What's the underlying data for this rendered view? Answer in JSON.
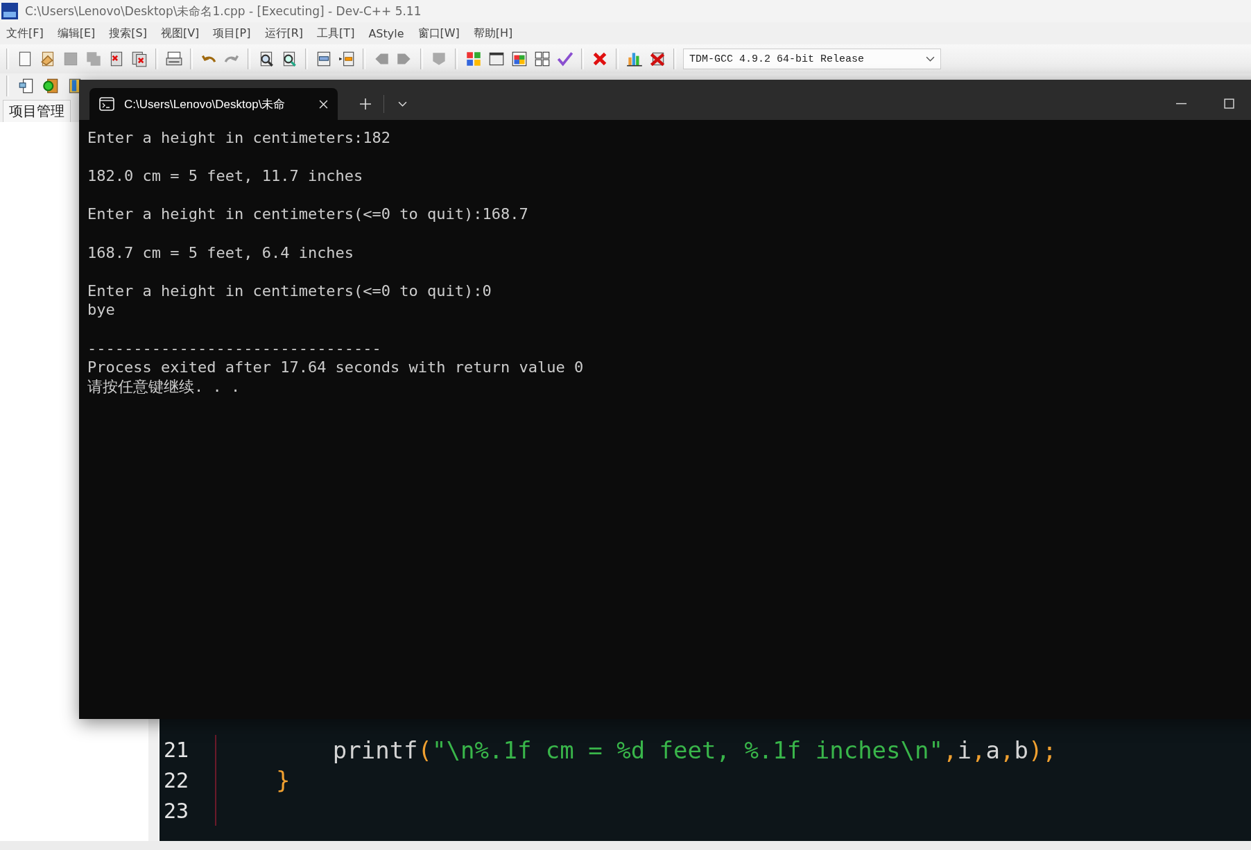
{
  "window": {
    "title": "C:\\Users\\Lenovo\\Desktop\\未命名1.cpp - [Executing] - Dev-C++ 5.11"
  },
  "menu": [
    "文件[F]",
    "编辑[E]",
    "搜索[S]",
    "视图[V]",
    "项目[P]",
    "运行[R]",
    "工具[T]",
    "AStyle",
    "窗口[W]",
    "帮助[H]"
  ],
  "compiler_select": {
    "value": "TDM-GCC 4.9.2 64-bit Release"
  },
  "left_panel": {
    "tabs": [
      {
        "label": "项目管理",
        "selected": true
      }
    ]
  },
  "editor": {
    "lines": [
      {
        "number": "21",
        "tokens": [
          {
            "t": "        printf",
            "kind": "plain"
          },
          {
            "t": "(",
            "kind": "punct"
          },
          {
            "t": "\"\\n%.1f cm = %d feet, %.1f inches\\n\"",
            "kind": "string"
          },
          {
            "t": ",",
            "kind": "punct"
          },
          {
            "t": "i",
            "kind": "plain"
          },
          {
            "t": ",",
            "kind": "punct"
          },
          {
            "t": "a",
            "kind": "plain"
          },
          {
            "t": ",",
            "kind": "punct"
          },
          {
            "t": "b",
            "kind": "plain"
          },
          {
            "t": ");",
            "kind": "punct"
          }
        ]
      },
      {
        "number": "22",
        "tokens": [
          {
            "t": "    }",
            "kind": "punct"
          }
        ]
      },
      {
        "number": "23"
      }
    ]
  },
  "console": {
    "tab_title": "C:\\Users\\Lenovo\\Desktop\\未命",
    "blocks": [
      [
        "Enter a height in centimeters:182"
      ],
      [
        "182.0 cm = 5 feet, 11.7 inches"
      ],
      [
        "Enter a height in centimeters(<=0 to quit):168.7"
      ],
      [
        "168.7 cm = 5 feet, 6.4 inches"
      ],
      [
        "Enter a height in centimeters(<=0 to quit):0",
        "bye"
      ],
      [
        "--------------------------------",
        "Process exited after 17.64 seconds with return value 0",
        "请按任意键继续. . ."
      ]
    ]
  }
}
